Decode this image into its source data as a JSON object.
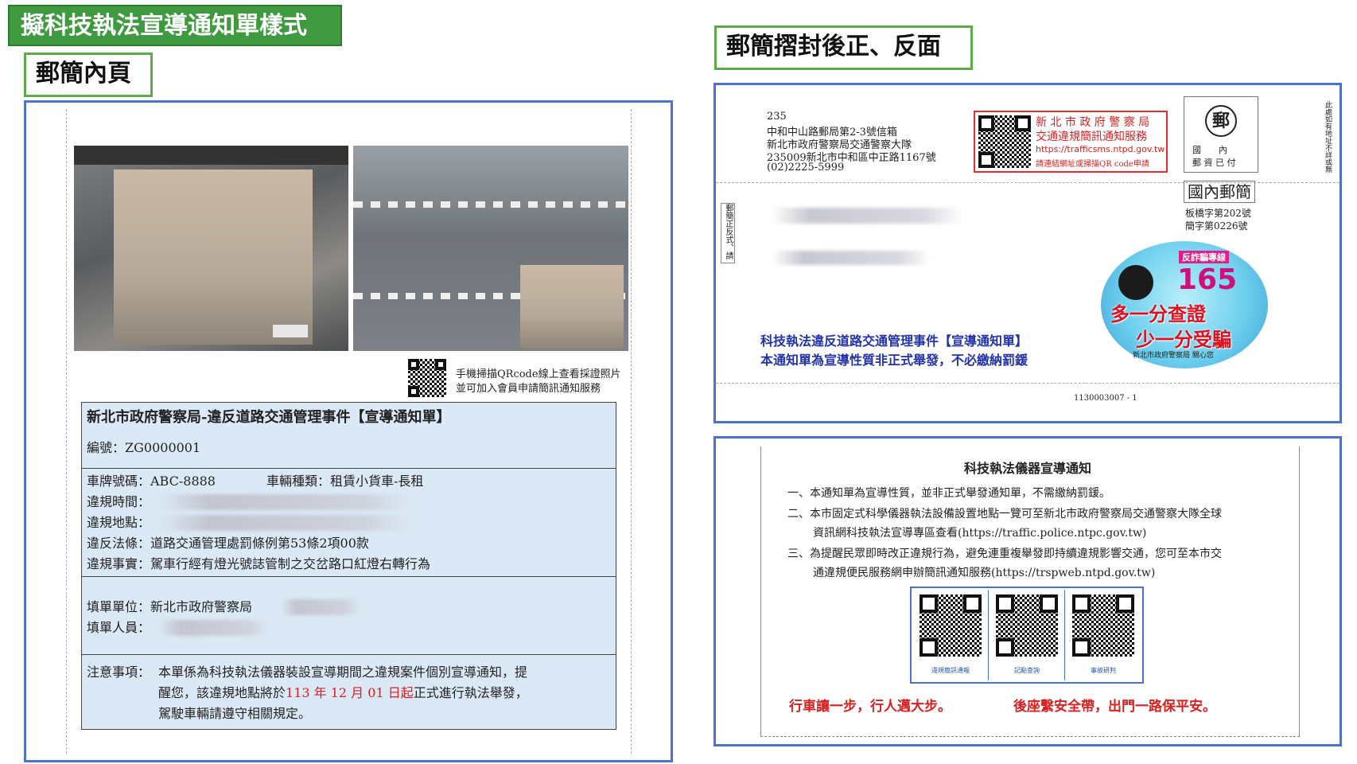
{
  "headers": {
    "main_title": "擬科技執法宣導通知單樣式",
    "inner_page": "郵簡內頁",
    "folded": "郵簡摺封後正、反面"
  },
  "left": {
    "qr_caption_1": "手機掃描QRcode線上查看採證照片",
    "qr_caption_2": "並可加入會員申請簡訊通知服務",
    "notice": {
      "title": "新北市政府警察局-違反道路交通管理事件【宣導通知單】",
      "number": "編號：ZG0000001",
      "plate": "車牌號碼：ABC-8888",
      "vehicle_type": "車輛種類：租賃小貨車-長租",
      "time_label": "違規時間：",
      "place_label": "違規地點：",
      "law": "違反法條：道路交通管理處罰條例第53條2項00款",
      "fact": "違規事實：駕車行經有燈光號誌管制之交岔路口紅燈右轉行為",
      "unit": "填單單位：新北市政府警察局",
      "staff_label": "填單人員：",
      "note_label": "注意事項：",
      "note_1": "本單係為科技執法儀器裝設宣導期間之違規案件個別宣導通知，提",
      "note_2a": "醒您，該違規地點將於",
      "note_2b": "113 年 12 月 01 日起",
      "note_2c": "正式進行執法舉發，",
      "note_3": "駕駛車輛請遵守相關規定。"
    }
  },
  "front": {
    "zip": "235",
    "addr_1": "中和中山路郵局第2-3號信箱",
    "addr_2": "新北市政府警察局交通警察大隊",
    "addr_3": "235009新北市中和區中正路1167號",
    "phone": "(02)2225-5999",
    "sms_1": "新 北 市 政 府 警 察 局",
    "sms_2": "交通違規簡訊通知服務",
    "sms_url": "https://trafficsms.ntpd.gov.tw",
    "sms_4": "請連結網址或掃描QR code申請",
    "postage_char": "郵",
    "postage_1": "國　　內",
    "postage_2": "郵 資 已 付",
    "domestic": "國內郵簡",
    "permit_1": "板橋字第202號",
    "permit_2": "簡字第0226號",
    "side_text": "郵簡正反式、請參考背面",
    "right_side_text": "此處如有地址不詳或無法投遞",
    "tech_1": "科技執法違反道路交通管理事件【宣導通知單】",
    "tech_2": "本通知單為宣導性質非正式舉發，不必繳納罰鍰",
    "serial": "1130003007 - 1",
    "badge_hotline": "反詐騙專線",
    "badge_num": "165",
    "badge_1": "多一分查證",
    "badge_2": "少一分受騙",
    "badge_org": "新北市政府警察局 關心您"
  },
  "back": {
    "title": "科技執法儀器宣導通知",
    "item_1": "一、本通知單為宣導性質，並非正式舉發通知單，不需繳納罰鍰。",
    "item_2a": "二、本市固定式科學儀器執法設備設置地點一覽可至新北市政府警察局交通警察大隊全球",
    "item_2b": "資訊網科技執法宣導專區查看(https://traffic.police.ntpc.gov.tw)",
    "item_3a": "三、為提醒民眾即時改正違規行為，避免連重複舉發即持續違規影響交通，您可至本市交",
    "item_3b": "通違規便民服務網申辦簡訊通知服務(https://trspweb.ntpd.gov.tw)",
    "qr_1": "違規簡訊通報",
    "qr_2": "記點查詢",
    "qr_3": "事故研判",
    "slogan_1": "行車讓一步，行人邁大步。",
    "slogan_2": "後座繫安全帶，出門一路保平安。"
  }
}
